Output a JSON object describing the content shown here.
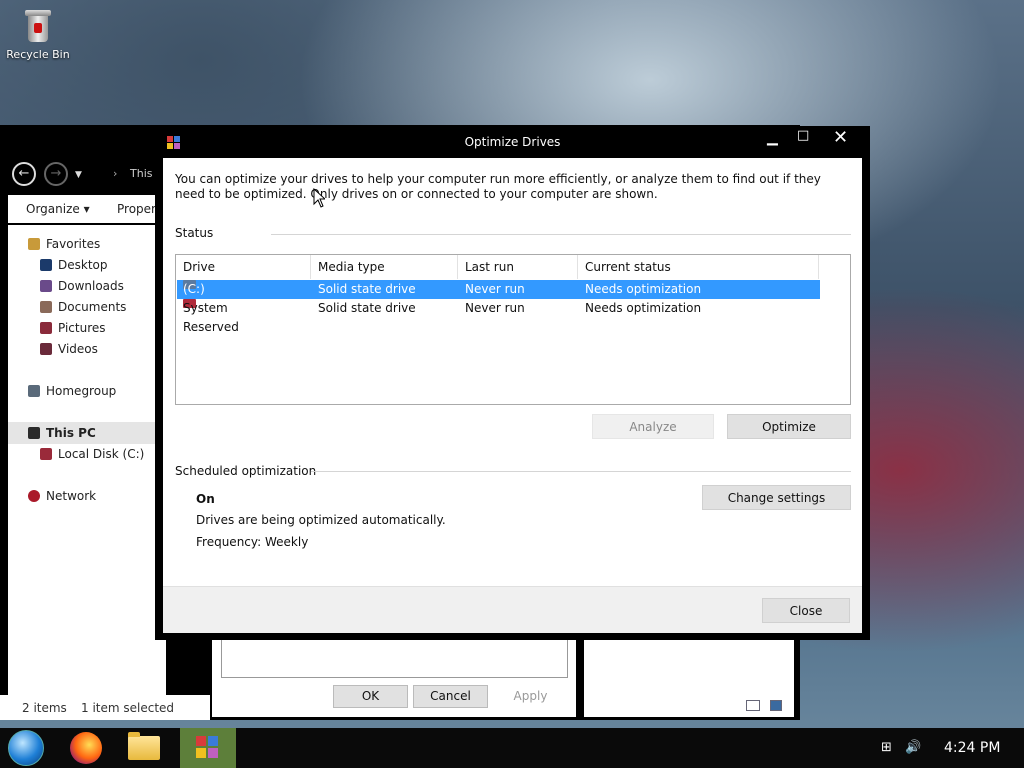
{
  "desktop": {
    "recycle_bin_label": "Recycle Bin"
  },
  "explorer": {
    "address": "This P",
    "toolbar": {
      "organize": "Organize ▾",
      "properties": "Propert"
    },
    "nav": {
      "favorites": "Favorites",
      "desktop": "Desktop",
      "downloads": "Downloads",
      "documents": "Documents",
      "pictures": "Pictures",
      "videos": "Videos",
      "homegroup": "Homegroup",
      "this_pc": "This PC",
      "local_disk": "Local Disk (C:)",
      "network": "Network"
    },
    "status": {
      "items": "2 items",
      "selected": "1 item selected"
    },
    "dialog_buttons": {
      "ok": "OK",
      "cancel": "Cancel",
      "apply": "Apply"
    }
  },
  "optimize": {
    "title": "Optimize Drives",
    "description": "You can optimize your drives to help your computer run more efficiently, or analyze them to find out if they need to be optimized. Only drives on or connected to your computer are shown.",
    "status_label": "Status",
    "columns": [
      "Drive",
      "Media type",
      "Last run",
      "Current status"
    ],
    "rows": [
      {
        "drive": "(C:)",
        "media": "Solid state drive",
        "last_run": "Never run",
        "status": "Needs optimization"
      },
      {
        "drive": "System Reserved",
        "media": "Solid state drive",
        "last_run": "Never run",
        "status": "Needs optimization"
      }
    ],
    "analyze_label": "Analyze",
    "optimize_label": "Optimize",
    "scheduled_label": "Scheduled optimization",
    "sched_state": "On",
    "sched_desc": "Drives are being optimized automatically.",
    "sched_freq": "Frequency: Weekly",
    "change_settings_label": "Change settings",
    "close_label": "Close"
  },
  "taskbar": {
    "clock": "4:24 PM"
  }
}
